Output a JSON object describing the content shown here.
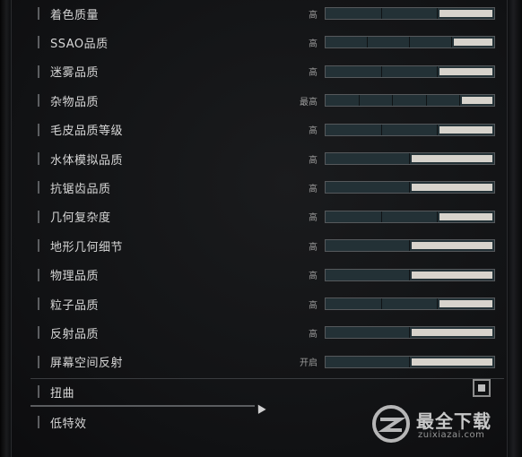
{
  "settings": [
    {
      "label": "着色质量",
      "value": "高",
      "segments": 3,
      "filled": 1
    },
    {
      "label": "SSAO品质",
      "value": "高",
      "segments": 4,
      "filled": 1
    },
    {
      "label": "迷雾品质",
      "value": "高",
      "segments": 3,
      "filled": 1
    },
    {
      "label": "杂物品质",
      "value": "最高",
      "segments": 5,
      "filled": 1
    },
    {
      "label": "毛皮品质等级",
      "value": "高",
      "segments": 3,
      "filled": 1
    },
    {
      "label": "水体模拟品质",
      "value": "高",
      "segments": 2,
      "filled": 1
    },
    {
      "label": "抗锯齿品质",
      "value": "高",
      "segments": 2,
      "filled": 1
    },
    {
      "label": "几何复杂度",
      "value": "高",
      "segments": 3,
      "filled": 1
    },
    {
      "label": "地形几何细节",
      "value": "高",
      "segments": 2,
      "filled": 1
    },
    {
      "label": "物理品质",
      "value": "高",
      "segments": 2,
      "filled": 1
    },
    {
      "label": "粒子品质",
      "value": "高",
      "segments": 3,
      "filled": 1
    },
    {
      "label": "反射品质",
      "value": "高",
      "segments": 2,
      "filled": 1
    },
    {
      "label": "屏幕空间反射",
      "value": "开启",
      "segments": 2,
      "filled": 1
    }
  ],
  "toggles": [
    {
      "label": "扭曲",
      "checked": true
    },
    {
      "label": "低特效"
    }
  ],
  "watermark": {
    "title": "最全下载",
    "sub": "zuixiazai.com"
  }
}
